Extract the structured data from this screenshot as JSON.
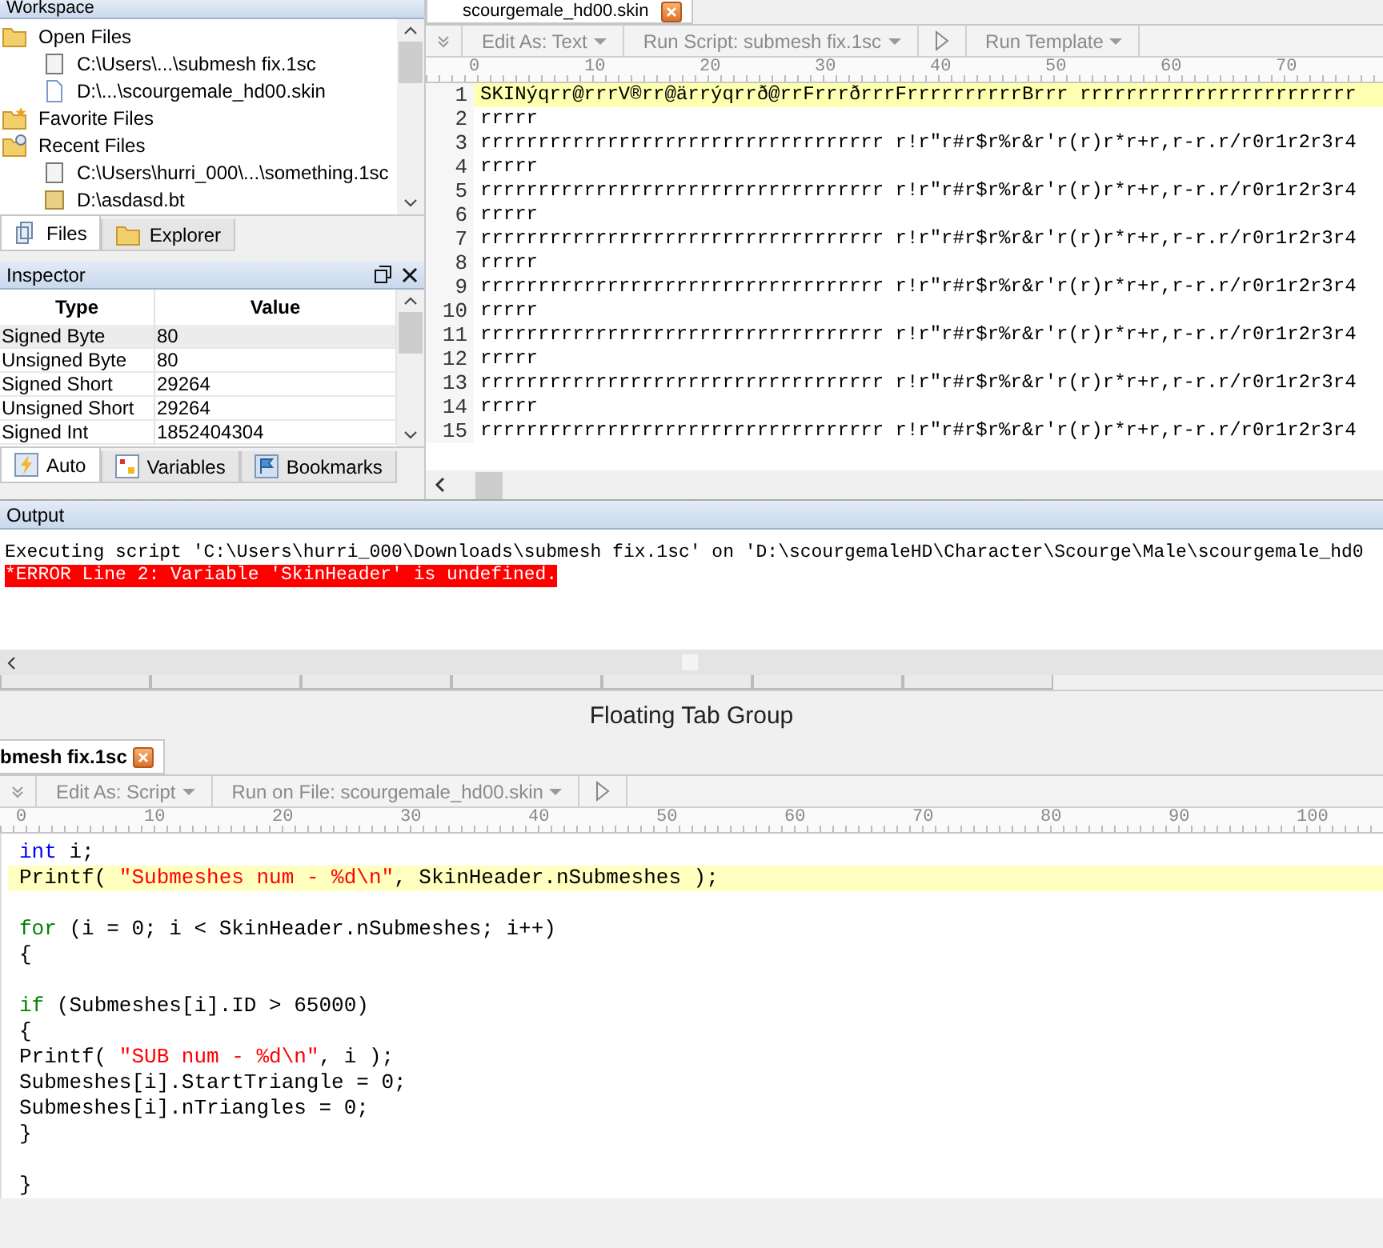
{
  "workspace": {
    "title": "Workspace",
    "tree": [
      {
        "label": "Open Files",
        "kind": "folder",
        "children": [
          {
            "label": "C:\\Users\\...\\submesh fix.1sc",
            "kind": "script"
          },
          {
            "label": "D:\\...\\scourgemale_hd00.skin",
            "kind": "file"
          }
        ]
      },
      {
        "label": "Favorite Files",
        "kind": "favorites"
      },
      {
        "label": "Recent Files",
        "kind": "recent",
        "children": [
          {
            "label": "C:\\Users\\hurri_000\\...\\something.1sc",
            "kind": "script"
          },
          {
            "label": "D:\\asdasd.bt",
            "kind": "template"
          }
        ]
      }
    ],
    "tabs": [
      {
        "label": "Files",
        "selected": true
      },
      {
        "label": "Explorer",
        "selected": false
      }
    ]
  },
  "inspector": {
    "title": "Inspector",
    "columns": [
      "Type",
      "Value"
    ],
    "rows": [
      {
        "type": "Signed Byte",
        "value": "80",
        "selected": true
      },
      {
        "type": "Unsigned Byte",
        "value": "80",
        "selected": false
      },
      {
        "type": "Signed Short",
        "value": "29264",
        "selected": false
      },
      {
        "type": "Unsigned Short",
        "value": "29264",
        "selected": false
      },
      {
        "type": "Signed Int",
        "value": "1852404304",
        "selected": false
      }
    ],
    "tabs": [
      {
        "label": "Auto",
        "selected": true
      },
      {
        "label": "Variables",
        "selected": false
      },
      {
        "label": "Bookmarks",
        "selected": false
      }
    ]
  },
  "editor": {
    "tab": {
      "label": "scourgemale_hd00.skin"
    },
    "toolbar": [
      {
        "kind": "dropdown",
        "label": "Edit As: Text"
      },
      {
        "kind": "dropdown",
        "label": "Run Script: submesh fix.1sc"
      },
      {
        "kind": "play"
      },
      {
        "kind": "dropdown",
        "label": "Run Template"
      }
    ],
    "ruler": [
      "0",
      "10",
      "20",
      "30",
      "40",
      "50",
      "60",
      "70"
    ],
    "lines": [
      {
        "number": "1",
        "text": "SKINýqrr@rrrV®rr@ärrýqrrð@rrFrrrðrrrFrrrrrrrrrrBrrr rrrrrrrrrrrrrrrrrrrrrrrr",
        "selected": true
      },
      {
        "number": "2",
        "text": "rrrrr",
        "selected": false
      },
      {
        "number": "3",
        "text": "rrrrrrrrrrrrrrrrrrrrrrrrrrrrrrrrrrr r!r\"r#r$r%r&r'r(r)r*r+r,r-r.r/r0r1r2r3r4",
        "selected": false
      },
      {
        "number": "4",
        "text": "rrrrr",
        "selected": false
      },
      {
        "number": "5",
        "text": "rrrrrrrrrrrrrrrrrrrrrrrrrrrrrrrrrrr r!r\"r#r$r%r&r'r(r)r*r+r,r-r.r/r0r1r2r3r4",
        "selected": false
      },
      {
        "number": "6",
        "text": "rrrrr",
        "selected": false
      },
      {
        "number": "7",
        "text": "rrrrrrrrrrrrrrrrrrrrrrrrrrrrrrrrrrr r!r\"r#r$r%r&r'r(r)r*r+r,r-r.r/r0r1r2r3r4",
        "selected": false
      },
      {
        "number": "8",
        "text": "rrrrr",
        "selected": false
      },
      {
        "number": "9",
        "text": "rrrrrrrrrrrrrrrrrrrrrrrrrrrrrrrrrrr r!r\"r#r$r%r&r'r(r)r*r+r,r-r.r/r0r1r2r3r4",
        "selected": false
      },
      {
        "number": "10",
        "text": "rrrrr",
        "selected": false
      },
      {
        "number": "11",
        "text": "rrrrrrrrrrrrrrrrrrrrrrrrrrrrrrrrrrr r!r\"r#r$r%r&r'r(r)r*r+r,r-r.r/r0r1r2r3r4",
        "selected": false
      },
      {
        "number": "12",
        "text": "rrrrr",
        "selected": false
      },
      {
        "number": "13",
        "text": "rrrrrrrrrrrrrrrrrrrrrrrrrrrrrrrrrrr r!r\"r#r$r%r&r'r(r)r*r+r,r-r.r/r0r1r2r3r4",
        "selected": false
      },
      {
        "number": "14",
        "text": "rrrrr",
        "selected": false
      },
      {
        "number": "15",
        "text": "rrrrrrrrrrrrrrrrrrrrrrrrrrrrrrrrrrr r!r\"r#r$r%r&r'r(r)r*r+r,r-r.r/r0r1r2r3r4",
        "selected": false
      }
    ]
  },
  "output": {
    "title": "Output",
    "lines": [
      {
        "kind": "info",
        "text": "Executing script 'C:\\Users\\hurri_000\\Downloads\\submesh fix.1sc' on 'D:\\scourgemaleHD\\Character\\Scourge\\Male\\scourgemale_hd0"
      },
      {
        "kind": "error",
        "text": "*ERROR Line 2: Variable 'SkinHeader' is undefined."
      }
    ]
  },
  "floating": {
    "title": "Floating Tab Group",
    "tab": {
      "label": "bmesh fix.1sc"
    },
    "toolbar": [
      {
        "kind": "dropdown",
        "label": "Edit As: Script"
      },
      {
        "kind": "dropdown",
        "label": "Run on File: scourgemale_hd00.skin"
      },
      {
        "kind": "play"
      }
    ],
    "ruler": [
      "0",
      "10",
      "20",
      "30",
      "40",
      "50",
      "60",
      "70",
      "80",
      "90",
      "100"
    ],
    "lines": [
      {
        "selected": false,
        "segments": [
          {
            "kind": "type",
            "text": "int"
          },
          {
            "kind": "plain",
            "text": " i;"
          }
        ]
      },
      {
        "selected": true,
        "segments": [
          {
            "kind": "plain",
            "text": "Printf( "
          },
          {
            "kind": "string",
            "text": "\"Submeshes num - %d\\n\""
          },
          {
            "kind": "plain",
            "text": ", SkinHeader.nSubmeshes );"
          }
        ]
      },
      {
        "selected": false
      },
      {
        "selected": false,
        "segments": [
          {
            "kind": "keyword",
            "text": "for"
          },
          {
            "kind": "plain",
            "text": " (i = 0; i < SkinHeader.nSubmeshes; i++)"
          }
        ]
      },
      {
        "selected": false,
        "segments": [
          {
            "kind": "plain",
            "text": "{"
          }
        ]
      },
      {
        "selected": false
      },
      {
        "selected": false,
        "segments": [
          {
            "kind": "keyword",
            "text": "if"
          },
          {
            "kind": "plain",
            "text": " (Submeshes[i].ID > 65000)"
          }
        ]
      },
      {
        "selected": false,
        "segments": [
          {
            "kind": "plain",
            "text": "{"
          }
        ]
      },
      {
        "selected": false,
        "segments": [
          {
            "kind": "plain",
            "text": "Printf( "
          },
          {
            "kind": "string",
            "text": "\"SUB num - %d\\n\""
          },
          {
            "kind": "plain",
            "text": ", i );"
          }
        ]
      },
      {
        "selected": false,
        "segments": [
          {
            "kind": "plain",
            "text": "Submeshes[i].StartTriangle = 0;"
          }
        ]
      },
      {
        "selected": false,
        "segments": [
          {
            "kind": "plain",
            "text": "Submeshes[i].nTriangles = 0;"
          }
        ]
      },
      {
        "selected": false,
        "segments": [
          {
            "kind": "plain",
            "text": "}"
          }
        ]
      },
      {
        "selected": false
      },
      {
        "selected": false,
        "segments": [
          {
            "kind": "plain",
            "text": "}"
          }
        ]
      }
    ]
  }
}
